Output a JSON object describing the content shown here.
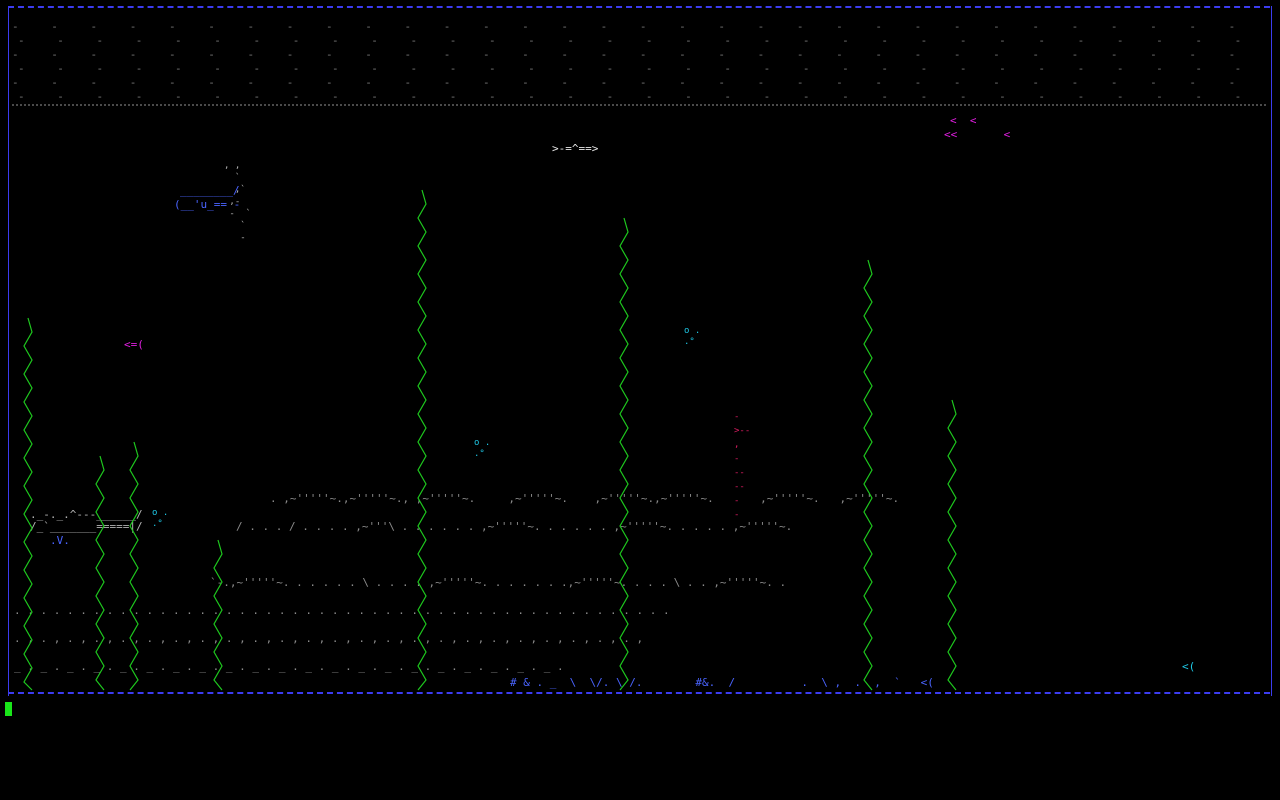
{
  "screen": {
    "app": "asciiquarium",
    "background": "#000000"
  },
  "colors": {
    "border": "#3c3cf0",
    "seaweed": "#1ec81e",
    "sand": "#8c8c8c",
    "fish_magenta": "#e01ee0",
    "fish_cyan": "#1ec8e6",
    "boat_blue": "#4a64ff",
    "cursor": "#19e619"
  },
  "surface": {
    "sky_row": "- - - - - - - - - - - - - - - - - - - - - - - - - - - - - - - - - - - - - - - - - - - - - - - - - - - - - - - - - - - - - - - - - - - - - - - - - - - - - - - - - - - - - - - - - - - - - - - - - - - - - - - - - - - - - - - - - - - - - - -"
  },
  "creatures": {
    "fish_white_top": ">-=^==>",
    "fish_magenta_top_1": "<  <",
    "fish_magenta_top_2": "<<       <",
    "fish_magenta_left": "<=(",
    "ship_line_1": "________/",
    "ship_line_2": "(__'u_== -",
    "bubbles_1": "o .\n.°",
    "bubbles_2": "o .\n.°",
    "bubbles_3": "o .\n.°",
    "fish_orange": "-\n>--\n,\n-\n--\n--\n-\n-",
    "castle_1": "._-._.^---______/",
    "castle_2": "/_`_______=====|/",
    "castle_3": ".V.",
    "fish_cyan_bottom": "<(",
    "ship_trail": ", ,\n  `\n  ,`\n ,-\n -  `\n   `\n   -"
  },
  "seabed": {
    "row_1": ". ,~'''''~.,~'''''~., ,~'''''~.     ,~'''''~.    ,~'''''~.,~'''''~.       ,~'''''~.   ,~'''''~.",
    "row_2": "/ . . . / . . . . ,~'''\\ . . . . . . ,~'''''~. . . . . . ,~'''''~. . . . . ,~'''''~.",
    "row_3": "`-.,~'''''~. . . . . . \\ . . . . ,~'''''~. . . . . . .,~'''''~. . . . \\ . . ,~'''''~. .",
    "row_4": ". . . . . . . . . . . . . . . . . . . . . . . . . . . . . . . . . . . . . . . . . . . . . . . . . .",
    "row_5": ". , . , . , . , . , . , . , . , . , . , . , . , . , . , . , . , . , . , . , . , . , . , . , . ,",
    "row_6": "# & . _  \\  \\/. \\ /.        #&.  /          .  \\ ,  .  ,  `   <(",
    "row_7": "_ . _ . _ . _ . _ . _ . _ . _ . _ . _ . _ . _ . _ . _ . _ . _ . _ . _ . _ . _ . _ ."
  },
  "prompt": {
    "cursor_label": ""
  }
}
